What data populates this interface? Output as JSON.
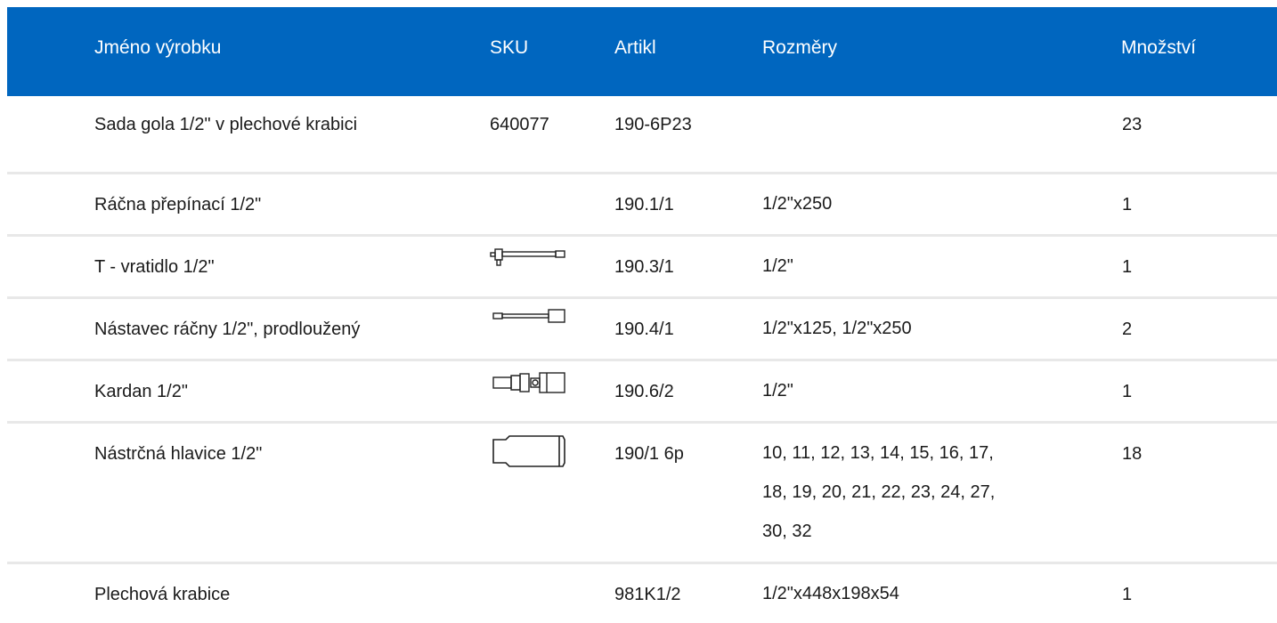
{
  "table": {
    "headers": {
      "name": "Jméno výrobku",
      "sku": "SKU",
      "artikl": "Artikl",
      "size": "Rozměry",
      "qty": "Množství"
    },
    "rows": [
      {
        "name": "Sada gola 1/2\" v plechové krabici",
        "sku": "640077",
        "artikl": "190-6P23",
        "size": "",
        "qty": "23",
        "icon": ""
      },
      {
        "name": "Ráčna přepínací 1/2\"",
        "sku": "",
        "artikl": "190.1/1",
        "size": "1/2\"x250",
        "qty": "1",
        "icon": ""
      },
      {
        "name": "T - vratidlo 1/2\"",
        "sku": "",
        "artikl": "190.3/1",
        "size": "1/2\"",
        "qty": "1",
        "icon": "t-handle-icon"
      },
      {
        "name": "Nástavec ráčny 1/2\", prodloužený",
        "sku": "",
        "artikl": "190.4/1",
        "size": "1/2\"x125, 1/2\"x250",
        "qty": "2",
        "icon": "extension-bar-icon"
      },
      {
        "name": "Kardan 1/2\"",
        "sku": "",
        "artikl": "190.6/2",
        "size": "1/2\"",
        "qty": "1",
        "icon": "universal-joint-icon"
      },
      {
        "name": "Nástrčná hlavice 1/2\"",
        "sku": "",
        "artikl": "190/1 6p",
        "size_lines": [
          "10, 11, 12, 13, 14, 15, 16, 17,",
          "18, 19, 20, 21, 22, 23, 24, 27,",
          "30, 32"
        ],
        "qty": "18",
        "icon": "socket-icon"
      },
      {
        "name": "Plechová krabice",
        "sku": "",
        "artikl": "981K1/2",
        "size": "1/2\"x448x198x54",
        "qty": "1",
        "icon": ""
      }
    ]
  }
}
